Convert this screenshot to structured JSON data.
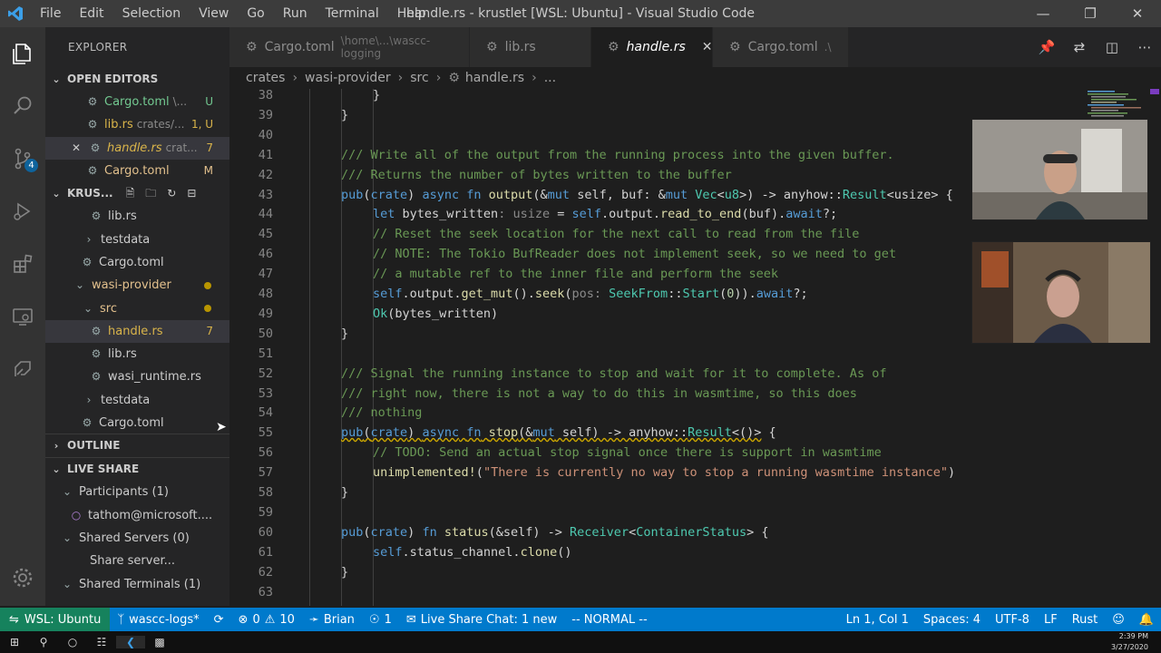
{
  "titlebar": {
    "menu": [
      "File",
      "Edit",
      "Selection",
      "View",
      "Go",
      "Run",
      "Terminal",
      "Help"
    ],
    "title": "handle.rs - krustlet [WSL: Ubuntu] - Visual Studio Code"
  },
  "activity": {
    "source_control_badge": "4"
  },
  "sidebar": {
    "title": "EXPLORER",
    "open_editors": {
      "header": "OPEN EDITORS",
      "items": [
        {
          "name": "Cargo.toml",
          "path": "\\...",
          "status": "U"
        },
        {
          "name": "lib.rs",
          "path": "crates/...",
          "status": "1, U"
        },
        {
          "name": "handle.rs",
          "path": "crat...",
          "status": "7"
        },
        {
          "name": "Cargo.toml",
          "path": "",
          "status": "M"
        }
      ]
    },
    "workspace": {
      "header": "KRUS...",
      "tree": [
        {
          "name": "lib.rs"
        },
        {
          "name": "testdata"
        },
        {
          "name": "Cargo.toml"
        },
        {
          "name": "wasi-provider"
        },
        {
          "name": "src"
        },
        {
          "name": "handle.rs",
          "status": "7"
        },
        {
          "name": "lib.rs"
        },
        {
          "name": "wasi_runtime.rs"
        },
        {
          "name": "testdata"
        },
        {
          "name": "Cargo.toml"
        }
      ]
    },
    "outline_header": "OUTLINE",
    "live_share": {
      "header": "LIVE SHARE",
      "participants": "Participants (1)",
      "participant": "tathom@microsoft....",
      "servers": "Shared Servers (0)",
      "share_server": "Share server...",
      "terminals": "Shared Terminals (1)"
    }
  },
  "tabs": [
    {
      "label": "Cargo.toml",
      "path": "\\home\\...\\wascc-logging",
      "active": false
    },
    {
      "label": "lib.rs",
      "path": "",
      "active": false
    },
    {
      "label": "handle.rs",
      "path": "",
      "active": true
    },
    {
      "label": "Cargo.toml",
      "path": ".\\",
      "active": false
    }
  ],
  "breadcrumb": [
    "crates",
    "wasi-provider",
    "src",
    "handle.rs",
    "..."
  ],
  "editor": {
    "line_numbers": [
      "38",
      "39",
      "40",
      "41",
      "42",
      "43",
      "44",
      "45",
      "46",
      "47",
      "48",
      "49",
      "50",
      "51",
      "52",
      "53",
      "54",
      "55",
      "56",
      "57",
      "58",
      "59",
      "60",
      "61",
      "62",
      "63"
    ]
  },
  "statusbar": {
    "remote": "WSL: Ubuntu",
    "branch": "wascc-logs*",
    "errors": "0",
    "warnings": "10",
    "user": "Brian",
    "live_count": "1",
    "live_share_chat": "Live Share Chat: 1 new",
    "vim_mode": "-- NORMAL --",
    "position": "Ln 1, Col 1",
    "spaces": "Spaces: 4",
    "encoding": "UTF-8",
    "eol": "LF",
    "language": "Rust"
  },
  "taskbar": {
    "time": "2:39 PM",
    "date": "3/27/2020"
  },
  "colors": {
    "accent": "#007acc",
    "remote": "#16825d",
    "modified": "#b89500"
  }
}
